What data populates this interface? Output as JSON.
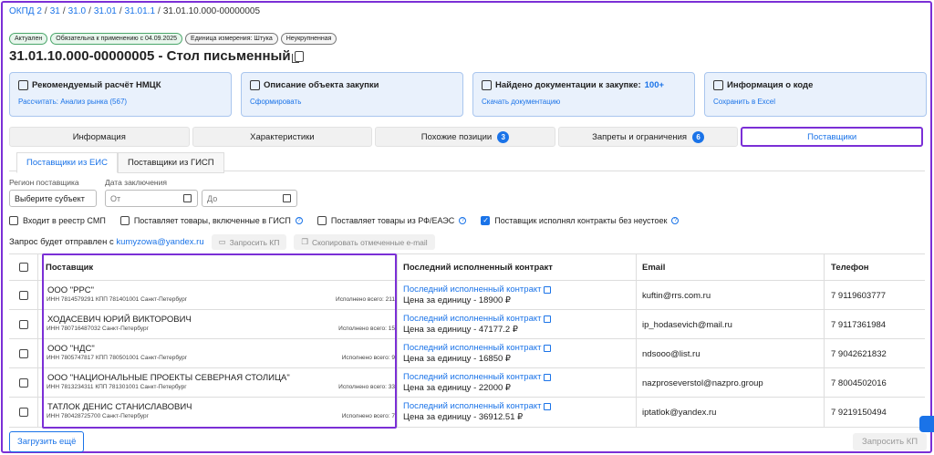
{
  "breadcrumb": {
    "items": [
      "ОКПД 2",
      "31",
      "31.0",
      "31.01",
      "31.01.1"
    ],
    "current": "31.01.10.000-00000005",
    "separator": "/"
  },
  "badges": [
    "Актуален",
    "Обязательна к применению с 04.09.2025",
    "Единица измерения: Штука",
    "Неукрупненная"
  ],
  "title": "31.01.10.000-00000005 - Стол письменный",
  "cards": [
    {
      "title": "Рекомендуемый расчёт НМЦК",
      "accent": "",
      "link": "Рассчитать: Анализ рынка (567)",
      "icon": "calculator-icon"
    },
    {
      "title": "Описание объекта закупки",
      "accent": "",
      "link": "Сформировать",
      "icon": "box-icon"
    },
    {
      "title": "Найдено документации к закупке:",
      "accent": "100+",
      "link": "Скачать документацию",
      "icon": "document-icon"
    },
    {
      "title": "Информация о коде",
      "accent": "",
      "link": "Сохранить в Excel",
      "icon": "list-icon"
    }
  ],
  "tabs": [
    {
      "label": "Информация",
      "count": ""
    },
    {
      "label": "Характеристики",
      "count": ""
    },
    {
      "label": "Похожие позиции",
      "count": "3"
    },
    {
      "label": "Запреты и ограничения",
      "count": "6"
    },
    {
      "label": "Поставщики",
      "count": ""
    }
  ],
  "subtabs": [
    "Поставщики из ЕИС",
    "Поставщики из ГИСП"
  ],
  "filters": {
    "region_label": "Регион поставщика",
    "region_value": "Выберите субъект",
    "date_label": "Дата заключения",
    "from_placeholder": "От",
    "to_placeholder": "До"
  },
  "checkboxes": [
    {
      "label": "Входит в реестр СМП",
      "checked": false,
      "help": false
    },
    {
      "label": "Поставляет товары, включенные в ГИСП",
      "checked": false,
      "help": true
    },
    {
      "label": "Поставляет товары из РФ/ЕАЭС",
      "checked": false,
      "help": true
    },
    {
      "label": "Поставщик исполнял контракты без неустоек",
      "checked": true,
      "help": true
    }
  ],
  "request": {
    "text": "Запрос будет отправлен с",
    "email": "kumyzowa@yandex.ru",
    "request_kp": "Запросить КП",
    "copy_emails": "Скопировать отмеченные e-mail"
  },
  "table": {
    "headers": {
      "supplier": "Поставщик",
      "contract": "Последний исполненный контракт",
      "email": "Email",
      "phone": "Телефон"
    },
    "rows": [
      {
        "name": "ООО \"РРС\"",
        "meta": "ИНН 7814579291   КПП 781401001   Санкт-Петербург",
        "done": "Исполнено всего: 211",
        "contract": "Последний исполненный контракт",
        "price": "Цена за единицу - 18900 ₽",
        "email": "kuftin@rrs.com.ru",
        "phone": "7 9119603777"
      },
      {
        "name": "ХОДАСЕВИЧ ЮРИЙ ВИКТОРОВИЧ",
        "meta": "ИНН 780716487032   Санкт-Петербург",
        "done": "Исполнено всего: 15",
        "contract": "Последний исполненный контракт",
        "price": "Цена за единицу - 47177.2 ₽",
        "email": "ip_hodasevich@mail.ru",
        "phone": "7 9117361984"
      },
      {
        "name": "ООО \"НДС\"",
        "meta": "ИНН 7805747817   КПП 780501001   Санкт-Петербург",
        "done": "Исполнено всего: 9",
        "contract": "Последний исполненный контракт",
        "price": "Цена за единицу - 16850 ₽",
        "email": "ndsooo@list.ru",
        "phone": "7 9042621832"
      },
      {
        "name": "ООО \"НАЦИОНАЛЬНЫЕ ПРОЕКТЫ СЕВЕРНАЯ СТОЛИЦА\"",
        "meta": "ИНН 7813234311   КПП 781301001   Санкт-Петербург",
        "done": "Исполнено всего: 33",
        "contract": "Последний исполненный контракт",
        "price": "Цена за единицу - 22000 ₽",
        "email": "nazproseverstol@nazpro.group",
        "phone": "7 8004502016"
      },
      {
        "name": "ТАТЛОК ДЕНИС СТАНИСЛАВОВИЧ",
        "meta": "ИНН 780428725700   Санкт-Петербург",
        "done": "Исполнено всего: 7",
        "contract": "Последний исполненный контракт",
        "price": "Цена за единицу - 36912.51 ₽",
        "email": "iptatlok@yandex.ru",
        "phone": "7 9219150494"
      }
    ]
  },
  "footer": {
    "load_more": "Загрузить ещё",
    "request_kp": "Запросить КП"
  },
  "colors": {
    "accent": "#1a73e8",
    "highlight": "#7b2fd6"
  }
}
